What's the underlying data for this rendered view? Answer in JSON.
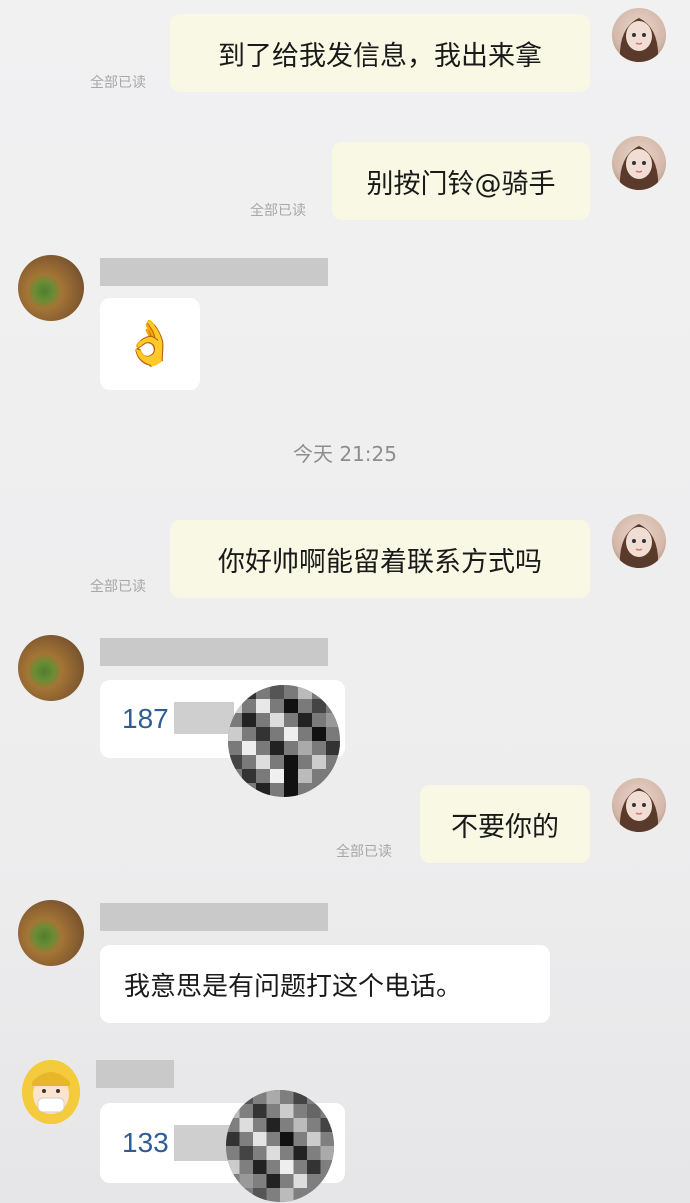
{
  "read_label": "全部已读",
  "time_divider": "今天  21:25",
  "messages": {
    "m1": "到了给我发信息，我出来拿",
    "m2": "别按门铃@骑手",
    "m3_emoji": "👌",
    "m4": "你好帅啊能留着联系方式吗",
    "m5_phone": "187",
    "m6": "不要你的",
    "m7": "我意思是有问题打这个电话。",
    "m8_phone": "133"
  },
  "icons": {
    "self_avatar": "avatar-girl-icon",
    "rider_avatar": "avatar-food-icon",
    "third_avatar": "avatar-masked-person-icon"
  }
}
